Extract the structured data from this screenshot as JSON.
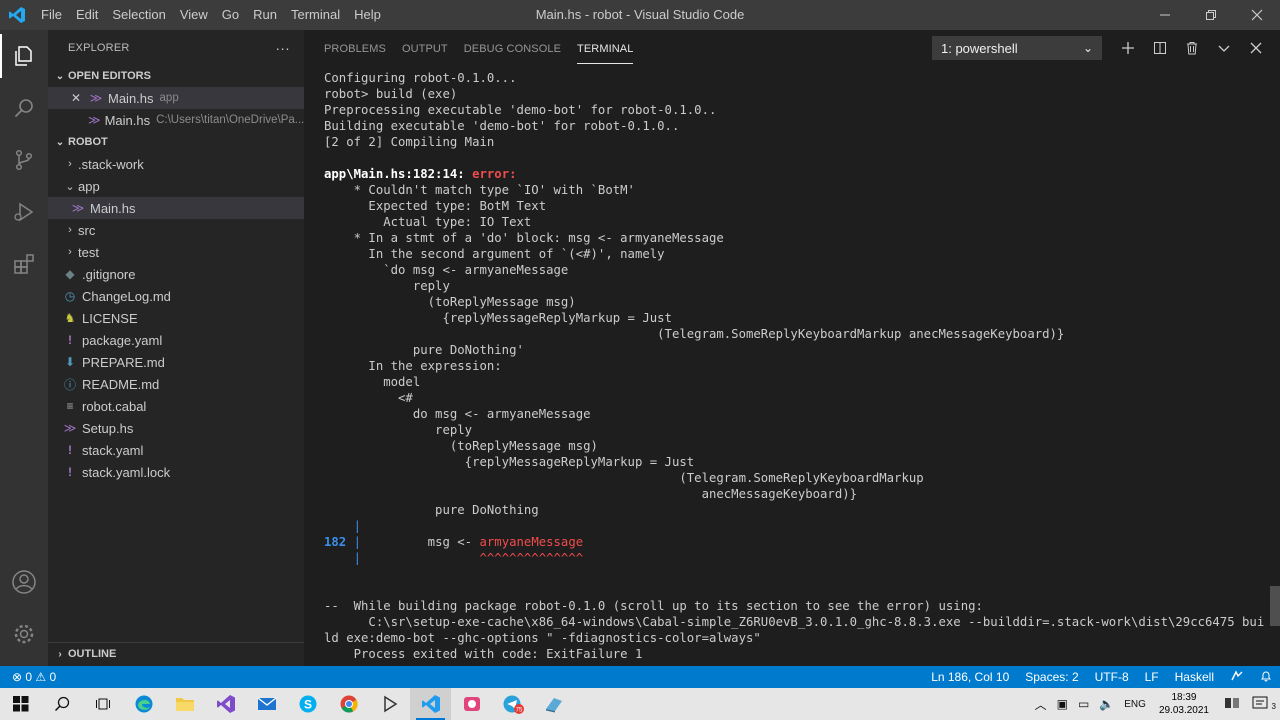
{
  "window": {
    "title": "Main.hs - robot - Visual Studio Code",
    "menu": [
      "File",
      "Edit",
      "Selection",
      "View",
      "Go",
      "Run",
      "Terminal",
      "Help"
    ]
  },
  "sidebar": {
    "title": "EXPLORER",
    "more": "···",
    "open_editors": {
      "label": "OPEN EDITORS",
      "items": [
        {
          "name": "Main.hs",
          "desc": "app"
        },
        {
          "name": "Main.hs",
          "desc": "C:\\Users\\titan\\OneDrive\\Pa..."
        }
      ]
    },
    "project": {
      "label": "ROBOT",
      "items": [
        {
          "name": ".stack-work",
          "icon": "chevron-right"
        },
        {
          "name": "app",
          "icon": "chevron-down"
        },
        {
          "name": "Main.hs",
          "icon": "haskell-icon"
        },
        {
          "name": "src",
          "icon": "chevron-right"
        },
        {
          "name": "test",
          "icon": "chevron-right"
        },
        {
          "name": ".gitignore",
          "icon": "git-icon"
        },
        {
          "name": "ChangeLog.md",
          "icon": "clock-icon"
        },
        {
          "name": "LICENSE",
          "icon": "license-icon"
        },
        {
          "name": "package.yaml",
          "icon": "yaml-icon"
        },
        {
          "name": "PREPARE.md",
          "icon": "markdown-icon"
        },
        {
          "name": "README.md",
          "icon": "info-icon"
        },
        {
          "name": "robot.cabal",
          "icon": "list-icon"
        },
        {
          "name": "Setup.hs",
          "icon": "haskell-icon"
        },
        {
          "name": "stack.yaml",
          "icon": "yaml-icon"
        },
        {
          "name": "stack.yaml.lock",
          "icon": "yaml-icon"
        }
      ]
    },
    "outline": "OUTLINE"
  },
  "panel": {
    "tabs": [
      "PROBLEMS",
      "OUTPUT",
      "DEBUG CONSOLE",
      "TERMINAL"
    ],
    "terminal_select": "1: powershell"
  },
  "terminal": {
    "lines": [
      "Configuring robot-0.1.0...",
      "robot> build (exe)",
      "Preprocessing executable 'demo-bot' for robot-0.1.0..",
      "Building executable 'demo-bot' for robot-0.1.0..",
      "[2 of 2] Compiling Main",
      "",
      "app\\Main.hs:182:14: |error:",
      "    * Couldn't match type `IO' with `BotM'",
      "      Expected type: BotM Text",
      "        Actual type: IO Text",
      "    * In a stmt of a 'do' block: msg <- armyaneMessage",
      "      In the second argument of `(<#)', namely",
      "        `do msg <- armyaneMessage",
      "            reply",
      "              (toReplyMessage msg)",
      "                {replyMessageReplyMarkup = Just",
      "                                             (Telegram.SomeReplyKeyboardMarkup anecMessageKeyboard)}",
      "            pure DoNothing'",
      "      In the expression:",
      "        model",
      "          <#",
      "            do msg <- armyaneMessage",
      "               reply",
      "                 (toReplyMessage msg)",
      "                   {replyMessageReplyMarkup = Just",
      "                                                (Telegram.SomeReplyKeyboardMarkup",
      "                                                   anecMessageKeyboard)}",
      "               pure DoNothing",
      "    |",
      "182 |         msg <- |armyaneMessage",
      "    |                |^^^^^^^^^^^^^^",
      "",
      "",
      "--  While building package robot-0.1.0 (scroll up to its section to see the error) using:",
      "      C:\\sr\\setup-exe-cache\\x86_64-windows\\Cabal-simple_Z6RU0evB_3.0.1.0_ghc-8.8.3.exe --builddir=.stack-work\\dist\\29cc6475 bui",
      "ld exe:demo-bot --ghc-options \" -fdiagnostics-color=always\"",
      "    Process exited with code: ExitFailure 1"
    ]
  },
  "statusbar": {
    "problems": "⊗ 0 ⚠ 0",
    "position": "Ln 186, Col 10",
    "spaces": "Spaces: 2",
    "encoding": "UTF-8",
    "eol": "LF",
    "language": "Haskell"
  },
  "taskbar": {
    "lang": "ENG",
    "time": "18:39",
    "date": "29.03.2021",
    "notif": "3",
    "badge": "75"
  },
  "colors": {
    "accent": "#007acc",
    "error": "#f14c4c",
    "line_number": "#3b8eea"
  }
}
